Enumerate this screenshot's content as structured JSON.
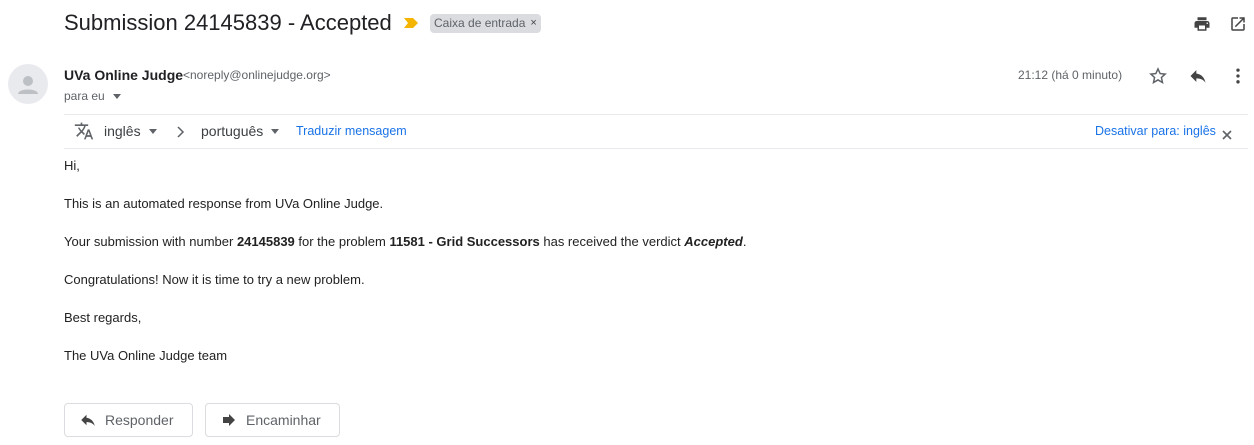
{
  "header": {
    "subject": "Submission 24145839 - Accepted",
    "label": "Caixa de entrada",
    "label_remove": "×"
  },
  "sender": {
    "name": "UVa Online Judge",
    "email": "<noreply@onlinejudge.org>",
    "to": "para eu",
    "time": "21:12 (há 0 minuto)"
  },
  "translate": {
    "source_lang": "inglês",
    "target_lang": "português",
    "translate_link": "Traduzir mensagem",
    "disable_link": "Desativar para: inglês"
  },
  "body": {
    "greeting": "Hi,",
    "line1": "This is an automated response from UVa Online Judge.",
    "line2_part1": "Your submission with number ",
    "line2_number": "24145839",
    "line2_part2": " for the problem ",
    "line2_problem": "11581 - Grid Successors",
    "line2_part3": " has received the verdict ",
    "line2_verdict": "Accepted",
    "line2_end": ".",
    "line3": "Congratulations! Now it is time to try a new problem.",
    "line4": "Best regards,",
    "line5": "The UVa Online Judge team"
  },
  "actions": {
    "reply": "Responder",
    "forward": "Encaminhar"
  },
  "colors": {
    "important_marker": "#f4b400",
    "link": "#1a73e8"
  }
}
